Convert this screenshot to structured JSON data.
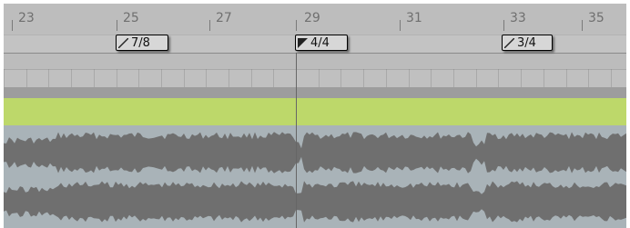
{
  "arrangement": {
    "bar_numbers": [
      "23",
      "25",
      "27",
      "29",
      "31",
      "33",
      "35"
    ],
    "time_signatures": [
      {
        "label": "7/8",
        "flag": "outline"
      },
      {
        "label": "4/4",
        "flag": "filled"
      },
      {
        "label": "3/4",
        "flag": "outline"
      }
    ]
  },
  "colors": {
    "ruler_bg": "#bdbdbd",
    "clip_header": "#bdd86a",
    "waveform_fill": "#6f6f6f",
    "waveform_bg": "#a9b3b8"
  },
  "icons": {
    "signature_flag": "triangle-flag-icon"
  }
}
